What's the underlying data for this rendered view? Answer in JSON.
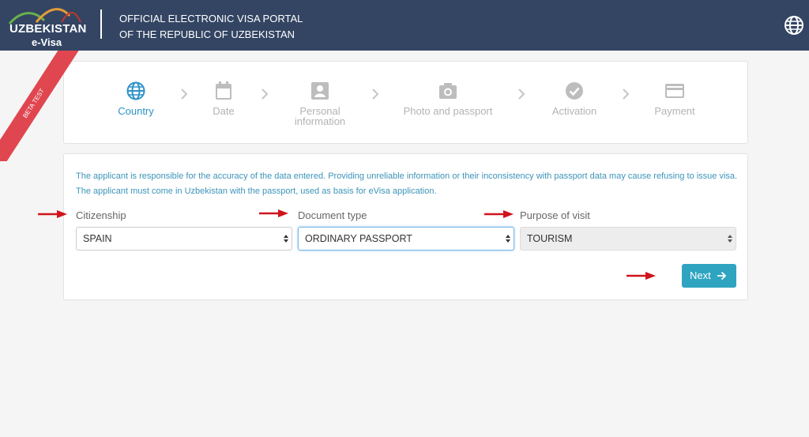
{
  "header": {
    "logo_text": "UZBEKISTAN",
    "logo_sub": "e-Visa",
    "title_line1": "OFFICIAL ELECTRONIC VISA PORTAL",
    "title_line2": "OF THE REPUBLIC OF UZBEKISTAN",
    "language_icon": "globe-icon"
  },
  "ribbon": "BETA TEST",
  "steps": [
    {
      "label": "Country",
      "icon": "globe-icon",
      "active": true
    },
    {
      "label": "Date",
      "icon": "calendar-icon",
      "active": false
    },
    {
      "label_line1": "Personal",
      "label_line2": "information",
      "icon": "user-card-icon",
      "active": false
    },
    {
      "label": "Photo and passport",
      "icon": "camera-icon",
      "active": false
    },
    {
      "label": "Activation",
      "icon": "check-circle-icon",
      "active": false
    },
    {
      "label": "Payment",
      "icon": "credit-card-icon",
      "active": false
    }
  ],
  "form": {
    "notice": "The applicant is responsible for the accuracy of the data entered. Providing unreliable information or their inconsistency with passport data may cause refusing to issue visa. The applicant must come in Uzbekistan with the passport, used as basis for eVisa application.",
    "citizenship": {
      "label": "Citizenship",
      "value": "SPAIN"
    },
    "document_type": {
      "label": "Document type",
      "value": "ORDINARY PASSPORT"
    },
    "purpose": {
      "label": "Purpose of visit",
      "value": "TOURISM"
    },
    "next_label": "Next"
  },
  "colors": {
    "header_bg": "#334563",
    "accent": "#2e92c9",
    "button": "#2fa4c1",
    "ribbon": "#e0464f",
    "annotation_arrow": "#d0141b"
  }
}
